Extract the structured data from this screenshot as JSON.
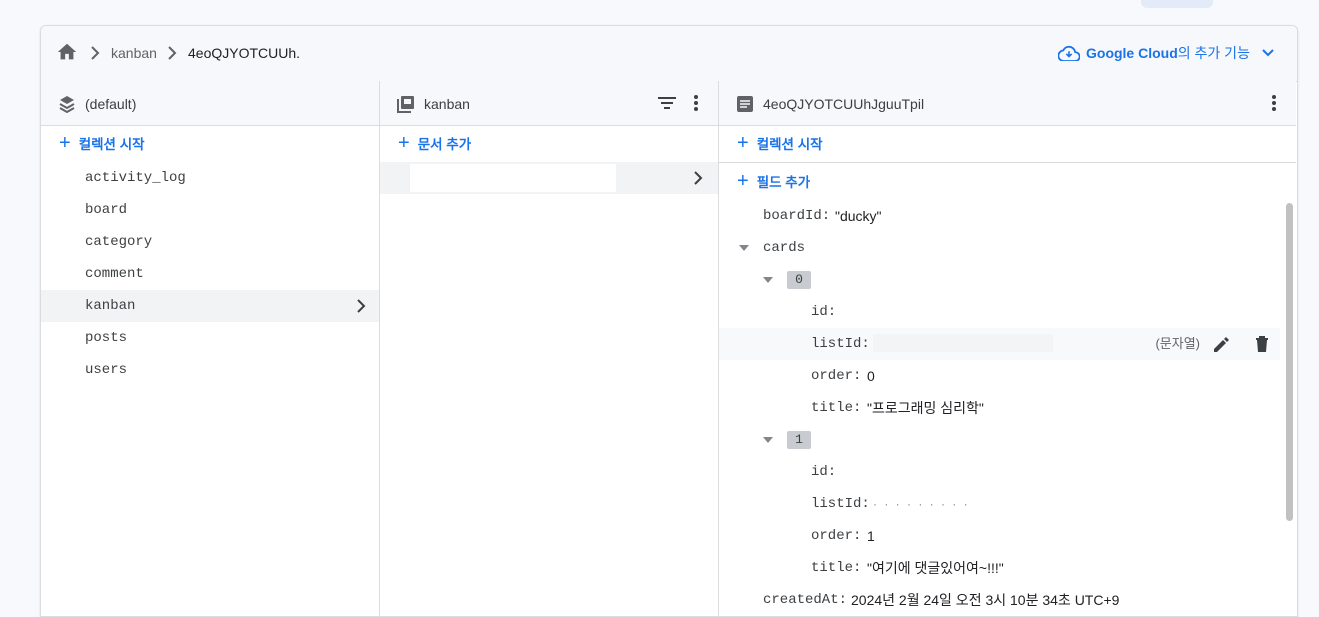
{
  "breadcrumb": {
    "items": [
      "kanban",
      "4eoQJYOTCUUh."
    ]
  },
  "gcloud": {
    "brand": "Google Cloud",
    "suffix": "의 추가 기능"
  },
  "col1": {
    "header": "(default)",
    "add_label": "컬렉션 시작",
    "collections": [
      "activity_log",
      "board",
      "category",
      "comment",
      "kanban",
      "posts",
      "users"
    ],
    "selected": "kanban"
  },
  "col2": {
    "header": "kanban",
    "add_label": "문서 추가"
  },
  "col3": {
    "header": "4eoQJYOTCUUhJguuTpil",
    "add_collection_label": "컬렉션 시작",
    "add_field_label": "필드 추가",
    "fields": {
      "boardId_key": "boardId:",
      "boardId_val": "\"ducky\"",
      "cards_key": "cards",
      "idx0": "0",
      "c0_id_key": "id:",
      "c0_listId_key": "listId:",
      "c0_type": "(문자열)",
      "c0_order_key": "order:",
      "c0_order_val": "0",
      "c0_title_key": "title:",
      "c0_title_val": "\"프로그래밍 심리학\"",
      "idx1": "1",
      "c1_id_key": "id:",
      "c1_listId_key": "listId:",
      "c1_order_key": "order:",
      "c1_order_val": "1",
      "c1_title_key": "title:",
      "c1_title_val": "\"여기에 댓글있어여~!!!\"",
      "createdAt_key": "createdAt:",
      "createdAt_val": "2024년 2월 24일 오전 3시 10분 34초 UTC+9"
    }
  },
  "colors": {
    "accent": "#1a73e8",
    "border": "#dadce0",
    "selected_bg": "#f1f3f4"
  }
}
